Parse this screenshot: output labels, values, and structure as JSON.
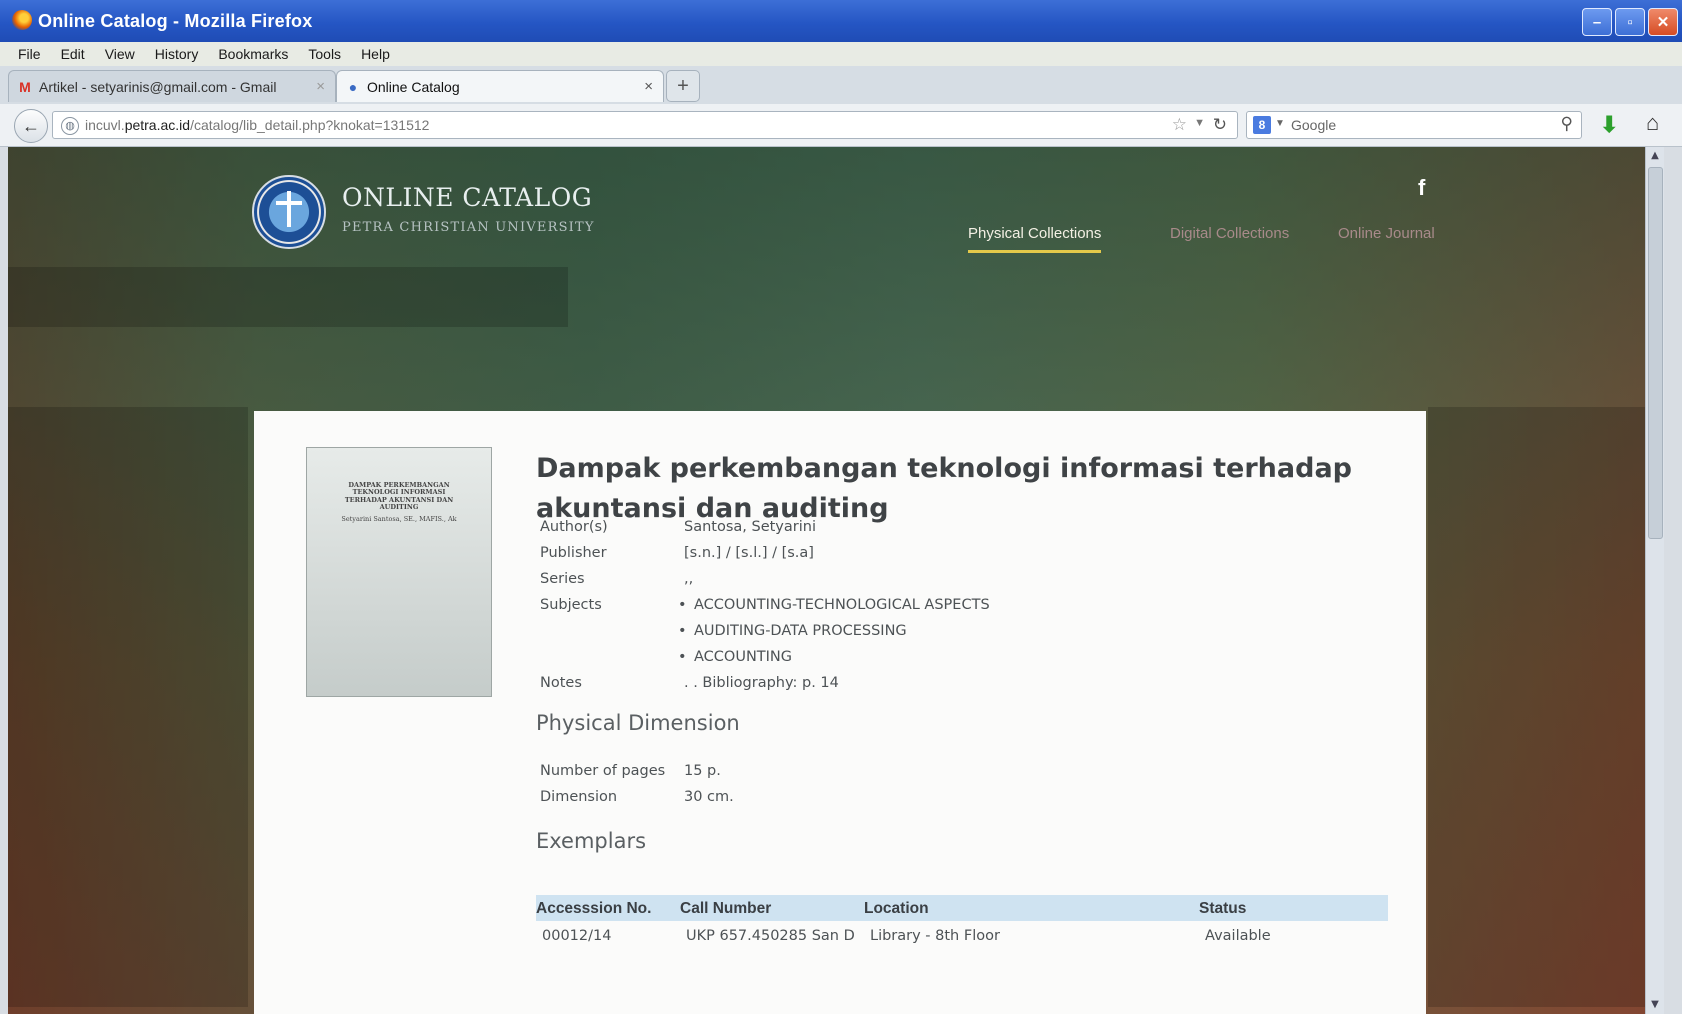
{
  "window": {
    "title": "Online Catalog - Mozilla Firefox",
    "buttons": {
      "minimize": "–",
      "restore": "▫",
      "close": "✕"
    }
  },
  "menu": [
    "File",
    "Edit",
    "View",
    "History",
    "Bookmarks",
    "Tools",
    "Help"
  ],
  "tabs": [
    {
      "label": "Artikel - setyarinis@gmail.com - Gmail",
      "icon": "gmail-icon",
      "active": false
    },
    {
      "label": "Online Catalog",
      "icon": "globe-icon",
      "active": true
    }
  ],
  "new_tab": "+",
  "address": {
    "url_pre": "incuvl.",
    "url_domain": "petra.ac.id",
    "url_post": "/catalog/lib_detail.php?knokat=131512"
  },
  "search": {
    "placeholder": "Google",
    "engine_badge": "8"
  },
  "site": {
    "title": "ONLINE CATALOG",
    "subtitle": "PETRA CHRISTIAN UNIVERSITY",
    "social": "f",
    "nav": [
      {
        "label": "Physical Collections",
        "active": true
      },
      {
        "label": "Digital Collections",
        "active": false
      },
      {
        "label": "Online Journal",
        "active": false
      }
    ]
  },
  "book": {
    "cover": {
      "title_lines": [
        "DAMPAK PERKEMBANGAN",
        "TEKNOLOGI INFORMASI",
        "TERHADAP AKUNTANSI DAN",
        "AUDITING"
      ],
      "author": "Setyarini Santosa, SE., MAFIS., Ak"
    },
    "title": "Dampak perkembangan teknologi informasi terhadap akuntansi dan auditing",
    "fields": {
      "author_label": "Author(s)",
      "author": "Santosa, Setyarini",
      "publisher_label": "Publisher",
      "publisher": "[s.n.] / [s.l.] / [s.a]",
      "series_label": "Series",
      "series": ",,",
      "subjects_label": "Subjects",
      "subjects": [
        "ACCOUNTING-TECHNOLOGICAL ASPECTS",
        "AUDITING-DATA PROCESSING",
        "ACCOUNTING"
      ],
      "notes_label": "Notes",
      "notes": ". . Bibliography: p. 14"
    },
    "physical": {
      "heading": "Physical Dimension",
      "pages_label": "Number of pages",
      "pages": "15 p.",
      "dimension_label": "Dimension",
      "dimension": "30 cm."
    },
    "exemplars": {
      "heading": "Exemplars",
      "columns": [
        "Accesssion No.",
        "Call Number",
        "Location",
        "Status"
      ],
      "rows": [
        [
          "00012/14",
          "UKP 657.450285 San D",
          "Library - 8th Floor",
          "Available"
        ]
      ]
    }
  },
  "colors": {
    "titlebar": "#2556c4",
    "nav_active_underline": "#e4c94a",
    "table_header": "#cfe3f1"
  }
}
